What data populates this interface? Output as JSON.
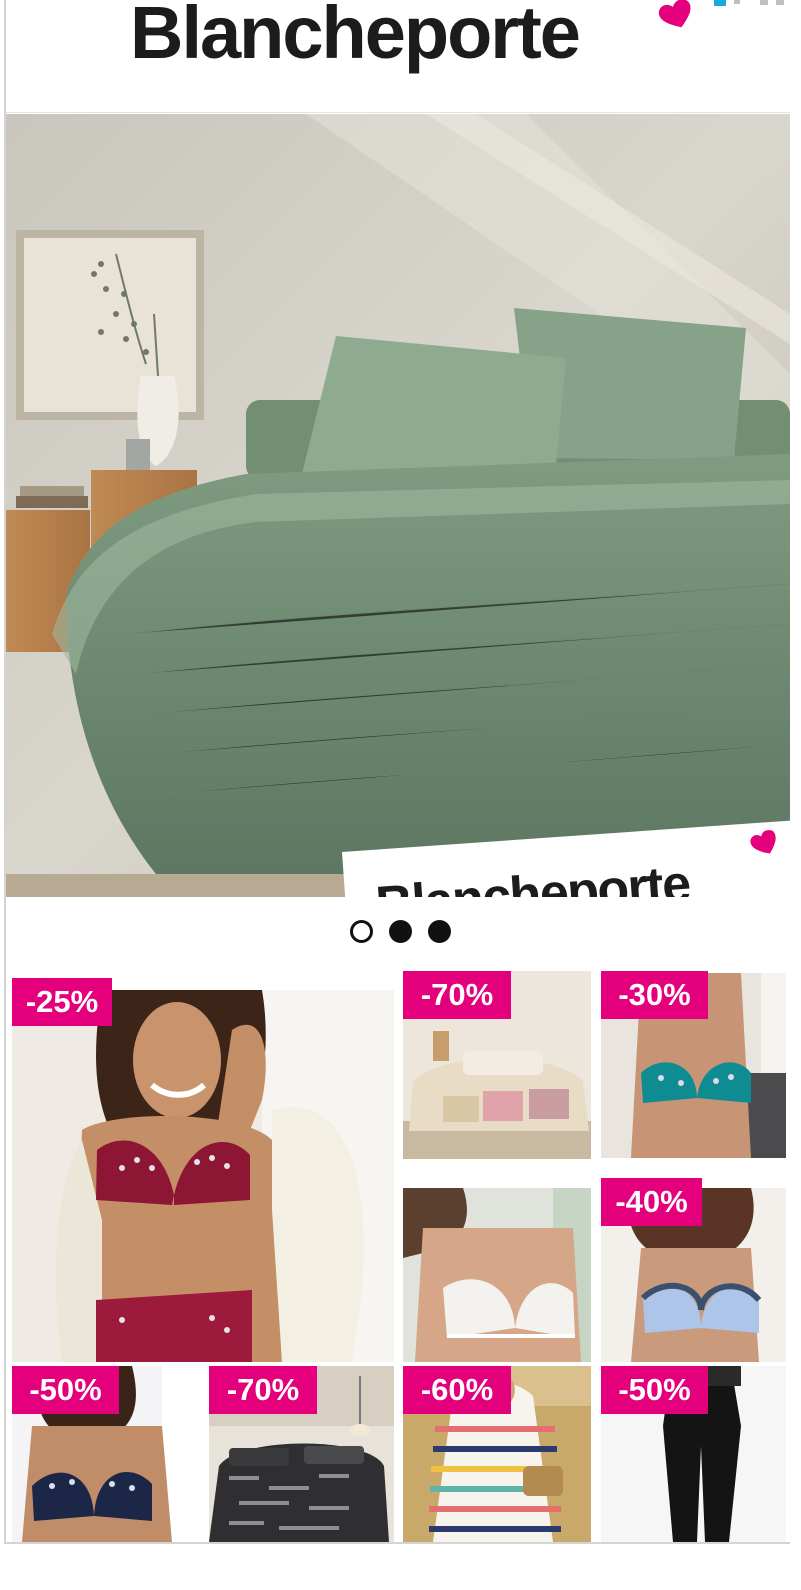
{
  "brand": {
    "name": "Blancheporte",
    "accent_color": "#e4007c",
    "heart_icon": "heart-icon"
  },
  "hero": {
    "badge_text": "Blancheporte",
    "carousel": {
      "count": 3,
      "active_index": 0
    }
  },
  "products": [
    {
      "id": "tile-bra-burgundy",
      "discount": "-25%"
    },
    {
      "id": "tile-bedding-patchwork",
      "discount": "-70%"
    },
    {
      "id": "tile-bra-teal",
      "discount": "-30%"
    },
    {
      "id": "tile-bra-white-lace",
      "discount": ""
    },
    {
      "id": "tile-bra-blue",
      "discount": "-40%"
    },
    {
      "id": "tile-bra-navy",
      "discount": "-50%"
    },
    {
      "id": "tile-bedding-text",
      "discount": "-70%"
    },
    {
      "id": "tile-sweater-stripes",
      "discount": "-60%"
    },
    {
      "id": "tile-pants-black",
      "discount": "-50%"
    }
  ]
}
